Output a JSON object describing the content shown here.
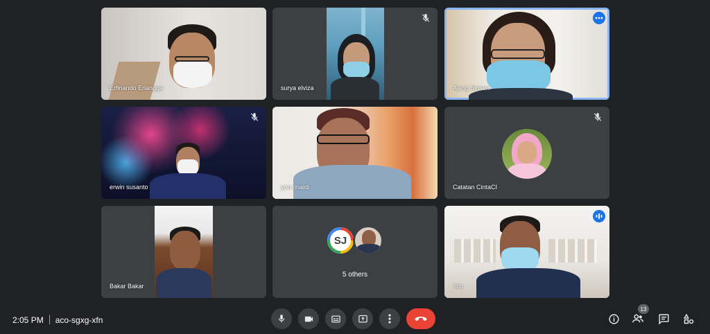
{
  "participants": [
    {
      "name": "Erfinando Erlangga"
    },
    {
      "name": "surya elviza"
    },
    {
      "name": "Ajeng Sinsen"
    },
    {
      "name": "erwin susanto"
    },
    {
      "name": "yon rinaldi"
    },
    {
      "name": "Catatan CintaCI"
    },
    {
      "name": "Bakar Bakar"
    },
    {
      "name": "You"
    }
  ],
  "others": {
    "initials": "SJ",
    "label": "5 others"
  },
  "meeting": {
    "time": "2:05 PM",
    "code": "aco-sgxg-xfn"
  },
  "people_count": "13",
  "colors": {
    "background": "#202124",
    "tile": "#3c4043",
    "accent": "#8ab4f8",
    "end_call": "#ea4335",
    "badge": "#1a73e8"
  },
  "icons": [
    "mic-off-icon",
    "more-options-icon",
    "audio-level-icon",
    "mic-icon",
    "camera-icon",
    "captions-icon",
    "present-icon",
    "more-vert-icon",
    "end-call-icon",
    "info-icon",
    "people-icon",
    "chat-icon",
    "activities-icon"
  ]
}
